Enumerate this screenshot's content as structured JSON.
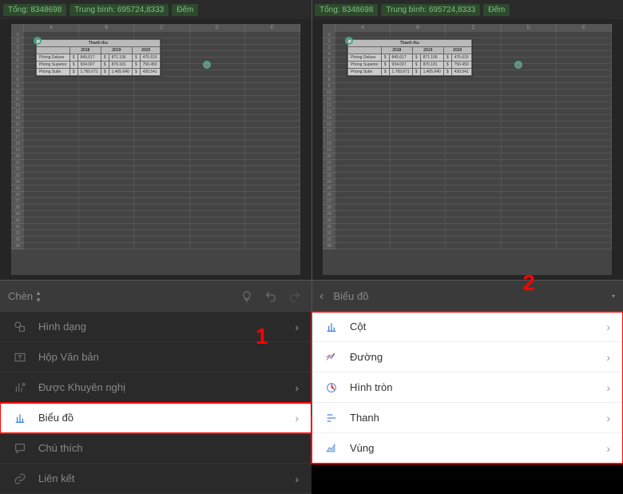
{
  "status": {
    "tong_label": "Tổng: 8348698",
    "tb_label": "Trung bình: 695724,8333",
    "dem_label": "Đếm"
  },
  "sheet": {
    "cols": [
      "A",
      "B",
      "C",
      "D",
      "E"
    ],
    "title": "Thanh thu",
    "years": [
      "2018",
      "2019",
      "2020"
    ],
    "rows": [
      {
        "name": "Phòng Deluxe",
        "v1": "845.617",
        "v2": "871.106",
        "v3": "475.615"
      },
      {
        "name": "Phòng Superior",
        "v1": "934.007",
        "v2": "870.181",
        "v3": "750.450"
      },
      {
        "name": "Phòng Suite",
        "v1": "1.765.671",
        "v2": "1.405.640",
        "v3": "430.541"
      }
    ]
  },
  "left": {
    "toolbar_label": "Chèn",
    "items": {
      "shape": "Hình dạng",
      "textbox": "Hộp Văn bản",
      "recommended": "Được Khuyên nghị",
      "chart": "Biểu đồ",
      "comment": "Chú thích",
      "link": "Liên kết"
    }
  },
  "right": {
    "toolbar_label": "Biểu đồ",
    "items": {
      "column": "Cột",
      "line": "Đường",
      "pie": "Hình tròn",
      "bar": "Thanh",
      "area": "Vùng"
    }
  },
  "annotations": {
    "one": "1",
    "two": "2"
  }
}
